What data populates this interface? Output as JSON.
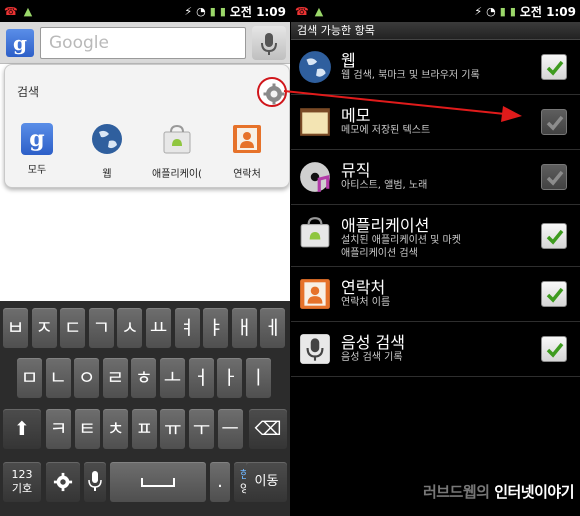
{
  "status_left": {
    "time": "오전 1:09"
  },
  "status_right": {
    "time": "오전 1:09"
  },
  "search": {
    "g_label": "g",
    "placeholder": "Google"
  },
  "popup": {
    "title": "검색",
    "sources": [
      {
        "label": "모두",
        "icon": "google-icon"
      },
      {
        "label": "웹",
        "icon": "globe-icon"
      },
      {
        "label": "애플리케이(",
        "icon": "android-bag-icon"
      },
      {
        "label": "연락처",
        "icon": "contact-card-icon"
      }
    ]
  },
  "keyboard": {
    "row1": [
      "ㅂ",
      "ㅈ",
      "ㄷ",
      "ㄱ",
      "ㅅ",
      "ㅛ",
      "ㅕ",
      "ㅑ",
      "ㅐ",
      "ㅔ"
    ],
    "row2": [
      "ㅁ",
      "ㄴ",
      "ㅇ",
      "ㄹ",
      "ㅎ",
      "ㅗ",
      "ㅓ",
      "ㅏ",
      "ㅣ"
    ],
    "row3": [
      "ㅋ",
      "ㅌ",
      "ㅊ",
      "ㅍ",
      "ㅠ",
      "ㅜ",
      "ㅡ"
    ],
    "shift": "⬆",
    "backspace": "⌫",
    "sym_top": "123",
    "sym_bottom": "기호",
    "period": ".",
    "lang_top": "한",
    "lang_bottom": "영",
    "move": "이동"
  },
  "right": {
    "header": "검색 가능한 항목",
    "items": [
      {
        "title": "웹",
        "subtitle": "웹 검색, 북마크 및 브라우저 기록",
        "subtitle2": "",
        "checked": true,
        "icon": "globe-icon"
      },
      {
        "title": "메모",
        "subtitle": "메모에 저장된 텍스트",
        "subtitle2": "",
        "checked": false,
        "icon": "memo-icon"
      },
      {
        "title": "뮤직",
        "subtitle": "아티스트, 앨범, 노래",
        "subtitle2": "",
        "checked": false,
        "icon": "music-cd-icon"
      },
      {
        "title": "애플리케이션",
        "subtitle": "설치된 애플리케이션 및 마켓",
        "subtitle2": "애플리케이션 검색",
        "checked": true,
        "icon": "android-bag-icon"
      },
      {
        "title": "연락처",
        "subtitle": "연락처 이름",
        "subtitle2": "",
        "checked": true,
        "icon": "contact-card-icon"
      },
      {
        "title": "음성 검색",
        "subtitle": "음성 검색 기록",
        "subtitle2": "",
        "checked": true,
        "icon": "microphone-icon"
      }
    ]
  },
  "watermark": {
    "part1": "러브드웹의 ",
    "part2": "인터넷이야기"
  },
  "colors": {
    "highlight_red": "#d0161b",
    "check_green": "#3e9b1f"
  }
}
